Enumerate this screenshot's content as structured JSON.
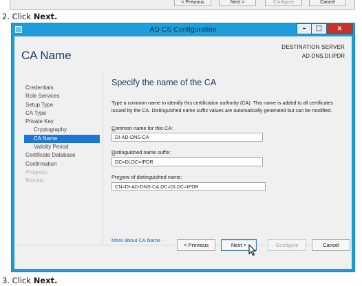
{
  "prev_crop": {
    "buttons": [
      "< Previous",
      "Next >",
      "Configure",
      "Cancel"
    ]
  },
  "steps": {
    "step2": {
      "number": "2.",
      "text": "Click ",
      "bold": "Next."
    },
    "step3": {
      "number": "3.",
      "text": "Click ",
      "bold": "Next."
    }
  },
  "window": {
    "title": "AD CS Configuration",
    "controls": {
      "minimize": "–",
      "maximize": "□",
      "close": "x"
    },
    "page_title": "CA Name",
    "destination_label": "DESTINATION SERVER",
    "destination_value": "AD-DNS.DI.IPDR"
  },
  "nav": [
    {
      "label": "Credentials",
      "level": "top",
      "state": "normal"
    },
    {
      "label": "Role Services",
      "level": "top",
      "state": "normal"
    },
    {
      "label": "Setup Type",
      "level": "top",
      "state": "normal"
    },
    {
      "label": "CA Type",
      "level": "top",
      "state": "normal"
    },
    {
      "label": "Private Key",
      "level": "top",
      "state": "normal"
    },
    {
      "label": "Cryptography",
      "level": "sub",
      "state": "normal"
    },
    {
      "label": "CA Name",
      "level": "sub",
      "state": "selected"
    },
    {
      "label": "Validity Period",
      "level": "sub",
      "state": "normal"
    },
    {
      "label": "Certificate Database",
      "level": "top",
      "state": "normal"
    },
    {
      "label": "Confirmation",
      "level": "top",
      "state": "normal"
    },
    {
      "label": "Progress",
      "level": "top",
      "state": "disabled"
    },
    {
      "label": "Results",
      "level": "top",
      "state": "disabled"
    }
  ],
  "content": {
    "heading": "Specify the name of the CA",
    "description": "Type a common name to identify this certification authority (CA). This name is added to all certificates issued by the CA. Distinguished name suffix values are automatically generated but can be modified.",
    "common_name": {
      "access_key": "C",
      "label_rest": "ommon name for this CA:",
      "value": "DI-AD-DNS-CA"
    },
    "dn_suffix": {
      "access_key": "D",
      "label_rest": "istinguished name suffix:",
      "value": "DC=DI,DC=IPDR"
    },
    "preview": {
      "label_pre": "Pre",
      "access_key": "v",
      "label_rest": "iew of distinguished name:",
      "value": "CN=DI-AD-DNS-CA,DC=DI,DC=IPDR"
    },
    "more_link": "More about CA Name"
  },
  "buttons": {
    "previous": "< Previous",
    "next": "Next >",
    "configure": "Configure",
    "cancel": "Cancel"
  }
}
